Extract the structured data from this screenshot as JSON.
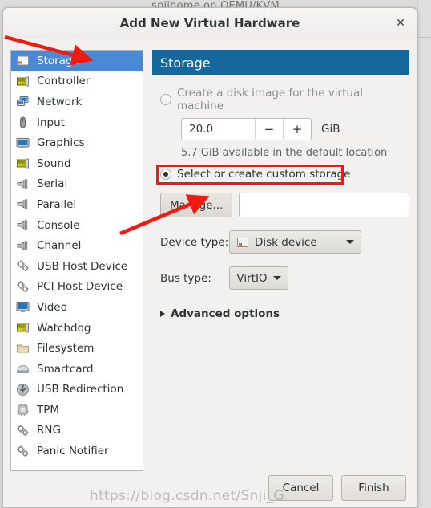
{
  "background": {
    "window_title": "snjihome on QEMU/KVM"
  },
  "dialog": {
    "title": "Add New Virtual Hardware",
    "close_icon": "close-icon"
  },
  "sidebar": {
    "items": [
      {
        "label": "Storage",
        "icon": "disk-device-icon",
        "selected": true
      },
      {
        "label": "Controller",
        "icon": "expansion-card-icon",
        "selected": false
      },
      {
        "label": "Network",
        "icon": "network-icon",
        "selected": false
      },
      {
        "label": "Input",
        "icon": "mouse-icon",
        "selected": false
      },
      {
        "label": "Graphics",
        "icon": "monitor-icon",
        "selected": false
      },
      {
        "label": "Sound",
        "icon": "expansion-card-icon",
        "selected": false
      },
      {
        "label": "Serial",
        "icon": "port-icon",
        "selected": false
      },
      {
        "label": "Parallel",
        "icon": "port-icon",
        "selected": false
      },
      {
        "label": "Console",
        "icon": "port-icon",
        "selected": false
      },
      {
        "label": "Channel",
        "icon": "port-icon",
        "selected": false
      },
      {
        "label": "USB Host Device",
        "icon": "gears-icon",
        "selected": false
      },
      {
        "label": "PCI Host Device",
        "icon": "gears-icon",
        "selected": false
      },
      {
        "label": "Video",
        "icon": "monitor-icon",
        "selected": false
      },
      {
        "label": "Watchdog",
        "icon": "expansion-card-icon",
        "selected": false
      },
      {
        "label": "Filesystem",
        "icon": "folder-icon",
        "selected": false
      },
      {
        "label": "Smartcard",
        "icon": "smartcard-icon",
        "selected": false
      },
      {
        "label": "USB Redirection",
        "icon": "usb-icon",
        "selected": false
      },
      {
        "label": "TPM",
        "icon": "chip-icon",
        "selected": false
      },
      {
        "label": "RNG",
        "icon": "gears-icon",
        "selected": false
      },
      {
        "label": "Panic Notifier",
        "icon": "gears-icon",
        "selected": false
      }
    ]
  },
  "content": {
    "section_title": "Storage",
    "header_color": "#15679c",
    "create_disk": {
      "label": "Create a disk image for the virtual machine",
      "checked": false,
      "size_value": "20.0",
      "minus_label": "−",
      "plus_label": "+",
      "unit": "GiB",
      "available_text": "5.7 GiB available in the default location"
    },
    "custom_storage": {
      "label": "Select or create custom storage",
      "checked": true,
      "highlight_color": "#f01a10"
    },
    "manage_button": "Manage...",
    "path_entry_value": "",
    "device_type": {
      "label": "Device type:",
      "value": "Disk device",
      "icon": "disk-device-icon"
    },
    "bus_type": {
      "label": "Bus type:",
      "value": "VirtIO"
    },
    "advanced_options": "Advanced options"
  },
  "footer": {
    "cancel_label": "Cancel",
    "finish_label": "Finish"
  },
  "annotations": {
    "watermark": "https://blog.csdn.net/Snji_G",
    "arrow_color": "#f01a10"
  }
}
